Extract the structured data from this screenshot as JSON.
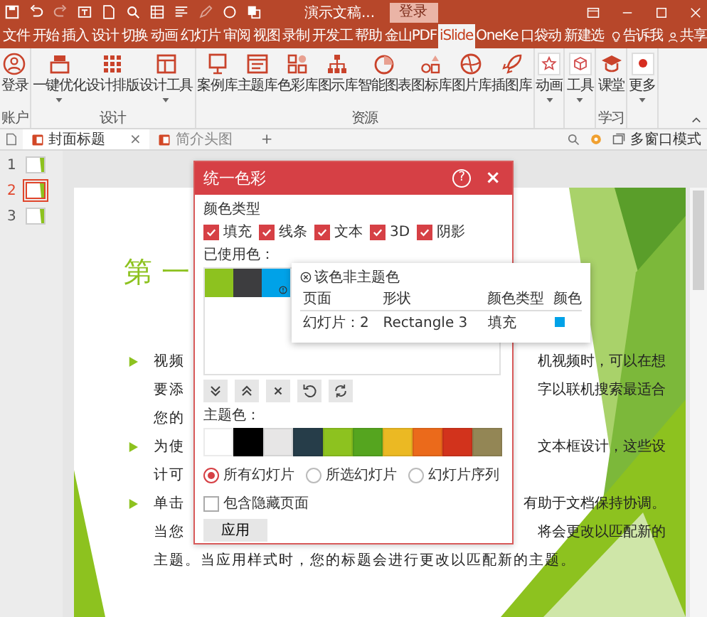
{
  "title_bar": {
    "document": "演示文稿...",
    "login": "登录"
  },
  "tabs": [
    {
      "label": "文件",
      "selected": false
    },
    {
      "label": "开始",
      "selected": false
    },
    {
      "label": "插入",
      "selected": false
    },
    {
      "label": "设计",
      "selected": false
    },
    {
      "label": "切换",
      "selected": false
    },
    {
      "label": "动画",
      "selected": false
    },
    {
      "label": "幻灯片",
      "selected": false
    },
    {
      "label": "审阅",
      "selected": false
    },
    {
      "label": "视图",
      "selected": false
    },
    {
      "label": "录制",
      "selected": false
    },
    {
      "label": "开发工",
      "selected": false
    },
    {
      "label": "帮助",
      "selected": false
    },
    {
      "label": "金山PDF",
      "selected": false
    },
    {
      "label": "iSlide",
      "selected": true
    },
    {
      "label": "OneKe",
      "selected": false
    },
    {
      "label": "口袋动",
      "selected": false
    },
    {
      "label": "新建选",
      "selected": false
    }
  ],
  "tell_me": "告诉我",
  "share": "共享",
  "ribbon": [
    {
      "label": "账户",
      "items": [
        {
          "kind": "user",
          "label": "登录",
          "dropdown": false
        }
      ]
    },
    {
      "label": "设计",
      "items": [
        {
          "kind": "tray",
          "label": "一键优化",
          "dropdown": true
        },
        {
          "kind": "grid",
          "label": "设计排版",
          "dropdown": false
        },
        {
          "kind": "layout",
          "label": "设计工具",
          "dropdown": true
        }
      ]
    },
    {
      "label": "资源",
      "items": [
        {
          "kind": "frame",
          "label": "案例库",
          "dropdown": false
        },
        {
          "kind": "card",
          "label": "主题库",
          "dropdown": false
        },
        {
          "kind": "squares",
          "label": "色彩库",
          "dropdown": false
        },
        {
          "kind": "tree",
          "label": "图示库",
          "dropdown": false
        },
        {
          "kind": "pie",
          "label": "智能图表",
          "dropdown": false
        },
        {
          "kind": "shapes",
          "label": "图标库",
          "dropdown": false
        },
        {
          "kind": "globe",
          "label": "图片库",
          "dropdown": false
        },
        {
          "kind": "rocket",
          "label": "插图库",
          "dropdown": false
        }
      ]
    },
    {
      "items": [
        {
          "kind": "star",
          "label": "动画",
          "dropdown": true
        }
      ]
    },
    {
      "items": [
        {
          "kind": "cube",
          "label": "工具",
          "dropdown": true
        }
      ]
    },
    {
      "label": "学习",
      "items": [
        {
          "kind": "cap",
          "label": "课堂",
          "dropdown": false
        }
      ]
    },
    {
      "items": [
        {
          "kind": "dot",
          "label": "更多",
          "dropdown": true
        }
      ]
    }
  ],
  "doc_tabs": [
    {
      "label": "封面标题",
      "selected": true
    },
    {
      "label": "简介头图",
      "selected": false
    }
  ],
  "doc_tab_close": "×",
  "add_tab": "+",
  "multi_window": "多窗口模式",
  "thumbnails": [
    {
      "number": "1",
      "selected": false
    },
    {
      "number": "2",
      "selected": true
    },
    {
      "number": "3",
      "selected": false
    }
  ],
  "slide": {
    "title": "第 一",
    "lines": [
      {
        "bullet": true,
        "left": "视频",
        "right": "机视频时，可以在想"
      },
      {
        "bullet": false,
        "left": "要添",
        "right": "字以联机搜索最适合"
      },
      {
        "bullet": false,
        "left": "您的"
      },
      {
        "bullet": true,
        "left": "为使",
        "right": "文本框设计，这些设"
      },
      {
        "bullet": false,
        "left": "计可"
      },
      {
        "bullet": true,
        "left": "单击",
        "right": "有助于文档保持协调。"
      },
      {
        "bullet": false,
        "left": "当您",
        "right": "将会更改以匹配新的"
      },
      {
        "bullet": false,
        "left": "主题。当应用样式时，您的标题会进行更改以匹配新的主题。"
      }
    ]
  },
  "dialog": {
    "title": "统一色彩",
    "help": "?",
    "close": "×",
    "color_type_label": "颜色类型",
    "color_types": [
      {
        "label": "填充",
        "checked": true
      },
      {
        "label": "线条",
        "checked": true
      },
      {
        "label": "文本",
        "checked": true
      },
      {
        "label": "3D",
        "checked": true
      },
      {
        "label": "阴影",
        "checked": true
      }
    ],
    "used_label": "已使用色：",
    "used_colors": [
      {
        "color": "#8dc21f",
        "flagged": false
      },
      {
        "color": "#3d3d3f",
        "flagged": false
      },
      {
        "color": "#00a2e8",
        "flagged": true
      }
    ],
    "tools": [
      {
        "kind": "down"
      },
      {
        "kind": "up"
      },
      {
        "kind": "delete"
      },
      {
        "kind": "undo"
      },
      {
        "kind": "refresh"
      }
    ],
    "theme_label": "主题色：",
    "theme_colors": [
      {
        "color": "#ffffff"
      },
      {
        "color": "#000000"
      },
      {
        "color": "#e7e6e6"
      },
      {
        "color": "#263d49"
      },
      {
        "color": "#8dc21f"
      },
      {
        "color": "#55a51f"
      },
      {
        "color": "#ebb923"
      },
      {
        "color": "#eb6a1b"
      },
      {
        "color": "#d2331c"
      },
      {
        "color": "#938655"
      }
    ],
    "scopes": [
      {
        "label": "所有幻灯片",
        "selected": true
      },
      {
        "label": "所选幻灯片",
        "selected": false
      },
      {
        "label": "幻灯片序列",
        "selected": false
      }
    ],
    "include_hidden": {
      "label": "包含隐藏页面",
      "checked": false
    },
    "apply": "应用"
  },
  "popup": {
    "title": "该色非主题色",
    "columns": [
      "页面",
      "形状",
      "颜色类型",
      "颜色"
    ],
    "rows": [
      {
        "page": "幻灯片：2",
        "shape": "Rectangle 3",
        "type": "填充",
        "color": "#00a2e8"
      }
    ]
  }
}
